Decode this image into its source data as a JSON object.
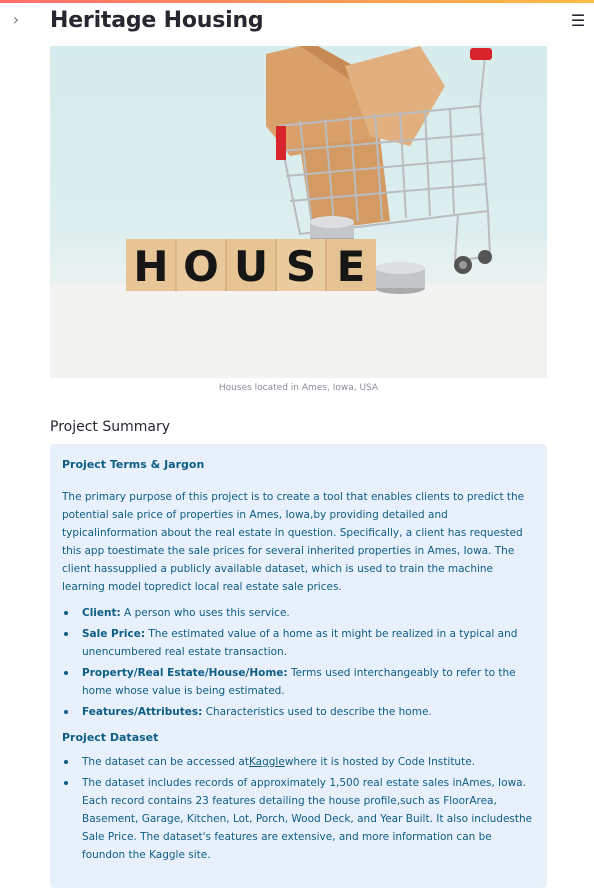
{
  "app": {
    "title": "Heritage Housing"
  },
  "hero": {
    "caption": "Houses located in Ames, Iowa, USA",
    "blocks": [
      "H",
      "O",
      "U",
      "S",
      "E"
    ]
  },
  "summary": {
    "heading": "Project Summary",
    "terms_heading": "Project Terms & Jargon",
    "intro": "The primary purpose of this project is to create a tool that enables clients to predict the potential sale price of properties in Ames, Iowa,by providing detailed and typicalinformation about the real estate in question. Specifically, a client has requested this app toestimate the sale prices for several inherited properties in Ames, Iowa. The client hassupplied a publicly available dataset, which is used to train the machine learning model topredict local real estate sale prices.",
    "terms": [
      {
        "term": "Client:",
        "desc": " A person who uses this service."
      },
      {
        "term": "Sale Price:",
        "desc": " The estimated value of a home as it might be realized in a typical and unencumbered real estate transaction."
      },
      {
        "term": "Property/Real Estate/House/Home:",
        "desc": " Terms used interchangeably to refer to the home whose value is being estimated."
      },
      {
        "term": "Features/Attributes:",
        "desc": " Characteristics used to describe the home."
      }
    ],
    "dataset_heading": "Project Dataset",
    "dataset_link": {
      "before": "The dataset can be accessed at",
      "link_text": "Kaggle",
      "after": "where it is hosted by Code Institute."
    },
    "dataset_desc": "The dataset includes records of approximately 1,500 real estate sales inAmes, Iowa. Each record contains 23 features detailing the house profile,such as FloorArea, Basement, Garage, Kitchen, Lot, Porch, Wood Deck, and Year Built. It also includesthe Sale Price. The dataset's features are extensive, and more information can be foundon the Kaggle site."
  },
  "icons": {
    "sidebar": "chevron-right-icon",
    "menu": "hamburger-menu-icon"
  }
}
